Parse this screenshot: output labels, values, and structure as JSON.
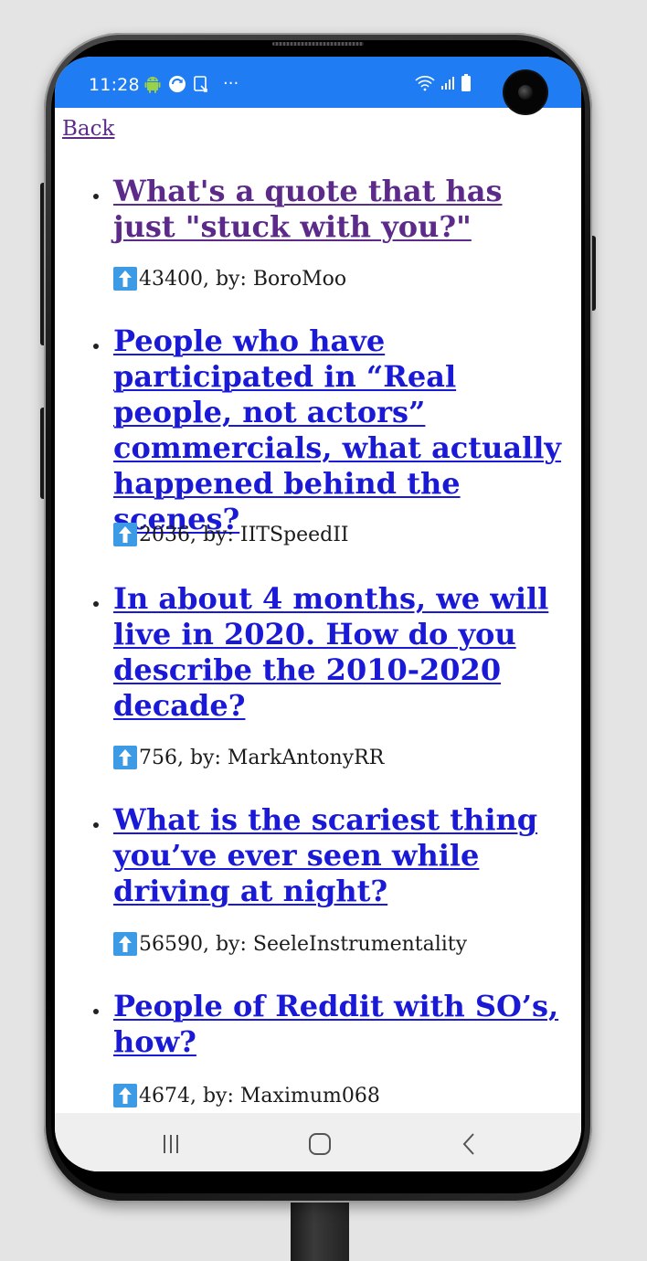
{
  "status_bar": {
    "time": "11:28",
    "left_icons": [
      "android-icon",
      "sync-icon",
      "screenshot-icon",
      "more-dots-icon"
    ],
    "right_icons": [
      "wifi-icon",
      "signal-icon",
      "battery-icon"
    ],
    "overflow": "···",
    "color": "#1f7cf2"
  },
  "back_link": "Back",
  "posts": [
    {
      "title": "What's a quote that has just \"stuck with you?\"",
      "score_line": "43400, by: BoroMoo",
      "visited": true
    },
    {
      "title": "People who have participated in “Real people, not actors” commercials, what actually happened behind the scenes?",
      "score_line": "2036, by: IITSpeedII",
      "visited": false
    },
    {
      "title": "In about 4 months, we will live in 2020. How do you describe the 2010-2020 decade?",
      "score_line": "756, by: MarkAntonyRR",
      "visited": false
    },
    {
      "title": "What is the scariest thing you’ve ever seen while driving at night?",
      "score_line": "56590, by: SeeleInstrumentality",
      "visited": false
    },
    {
      "title": "People of Reddit with SO’s, how?",
      "score_line": "4674, by: Maximum068",
      "visited": false
    }
  ],
  "colors": {
    "link": "#1a1ad6",
    "visited_link": "#5c2b8a",
    "upvote_icon": "#3d9be6",
    "nav_bar": "#efefef"
  },
  "nav_bar": {
    "buttons": [
      "recents-icon",
      "home-icon",
      "back-arrow-icon"
    ]
  }
}
